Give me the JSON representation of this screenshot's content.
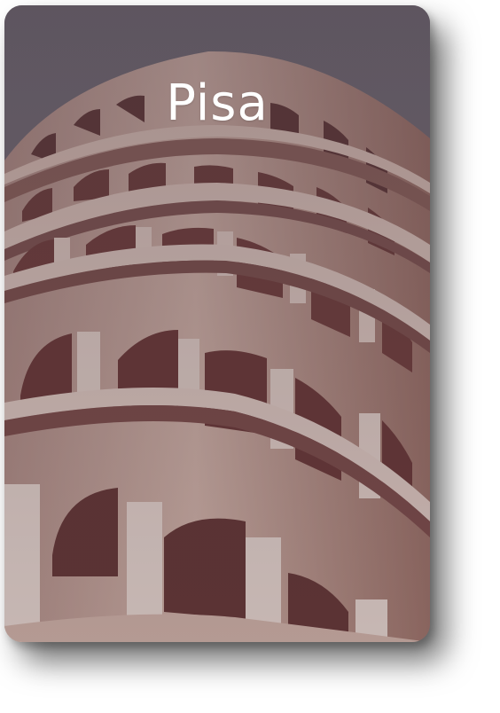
{
  "card": {
    "title": "Pisa",
    "image_subject": "leaning-tower-of-pisa-arcades",
    "overlay_color": "#5c5560",
    "sky_color": "#6f6a72",
    "stone_color": "#c9a79a",
    "shadow_color": "#000000"
  }
}
